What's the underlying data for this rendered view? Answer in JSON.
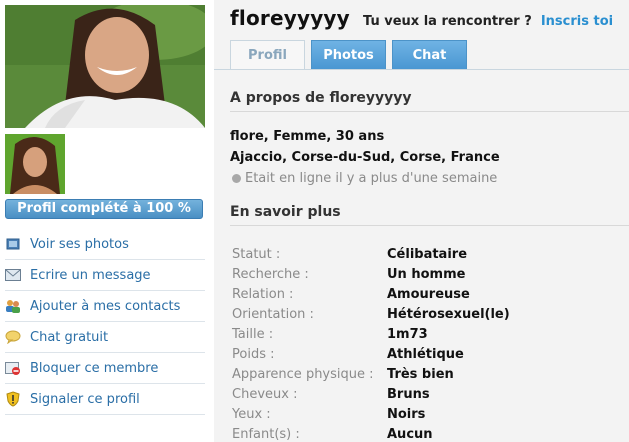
{
  "sidebar": {
    "progress_label": "Profil complété à 100 %",
    "progress_percent": 100,
    "menu": [
      {
        "label": "Voir ses photos",
        "icon": "photo-icon"
      },
      {
        "label": "Ecrire un message",
        "icon": "envelope-icon"
      },
      {
        "label": "Ajouter à mes contacts",
        "icon": "contacts-icon"
      },
      {
        "label": "Chat gratuit",
        "icon": "chat-bubble-icon"
      },
      {
        "label": "Bloquer ce membre",
        "icon": "block-icon"
      },
      {
        "label": "Signaler ce profil",
        "icon": "warning-shield-icon"
      }
    ]
  },
  "header": {
    "username": "floreyyyyy",
    "meet_prompt": "Tu veux la rencontrer ?",
    "signup_link": "Inscris toi"
  },
  "tabs": [
    {
      "label": "Profil",
      "active": true
    },
    {
      "label": "Photos",
      "active": false
    },
    {
      "label": "Chat",
      "active": false
    }
  ],
  "about": {
    "title": "A propos de floreyyyyy",
    "line1": "flore, Femme, 30 ans",
    "line2": "Ajaccio, Corse-du-Sud, Corse, France",
    "online_status": "Etait en ligne il y a plus d'une semaine"
  },
  "more": {
    "title": "En savoir plus",
    "rows": [
      {
        "label": "Statut :",
        "value": "Célibataire"
      },
      {
        "label": "Recherche :",
        "value": "Un homme"
      },
      {
        "label": "Relation :",
        "value": "Amoureuse"
      },
      {
        "label": "Orientation :",
        "value": "Hétérosexuel(le)"
      },
      {
        "label": "Taille :",
        "value": "1m73"
      },
      {
        "label": "Poids :",
        "value": "Athlétique"
      },
      {
        "label": "Apparence physique :",
        "value": "Très bien"
      },
      {
        "label": "Cheveux :",
        "value": "Bruns"
      },
      {
        "label": "Yeux :",
        "value": "Noirs"
      },
      {
        "label": "Enfant(s) :",
        "value": "Aucun"
      }
    ]
  },
  "colors": {
    "link_blue": "#2a6ea6",
    "tab_blue": "#4a97d2",
    "signup_blue": "#2a8fd0"
  }
}
